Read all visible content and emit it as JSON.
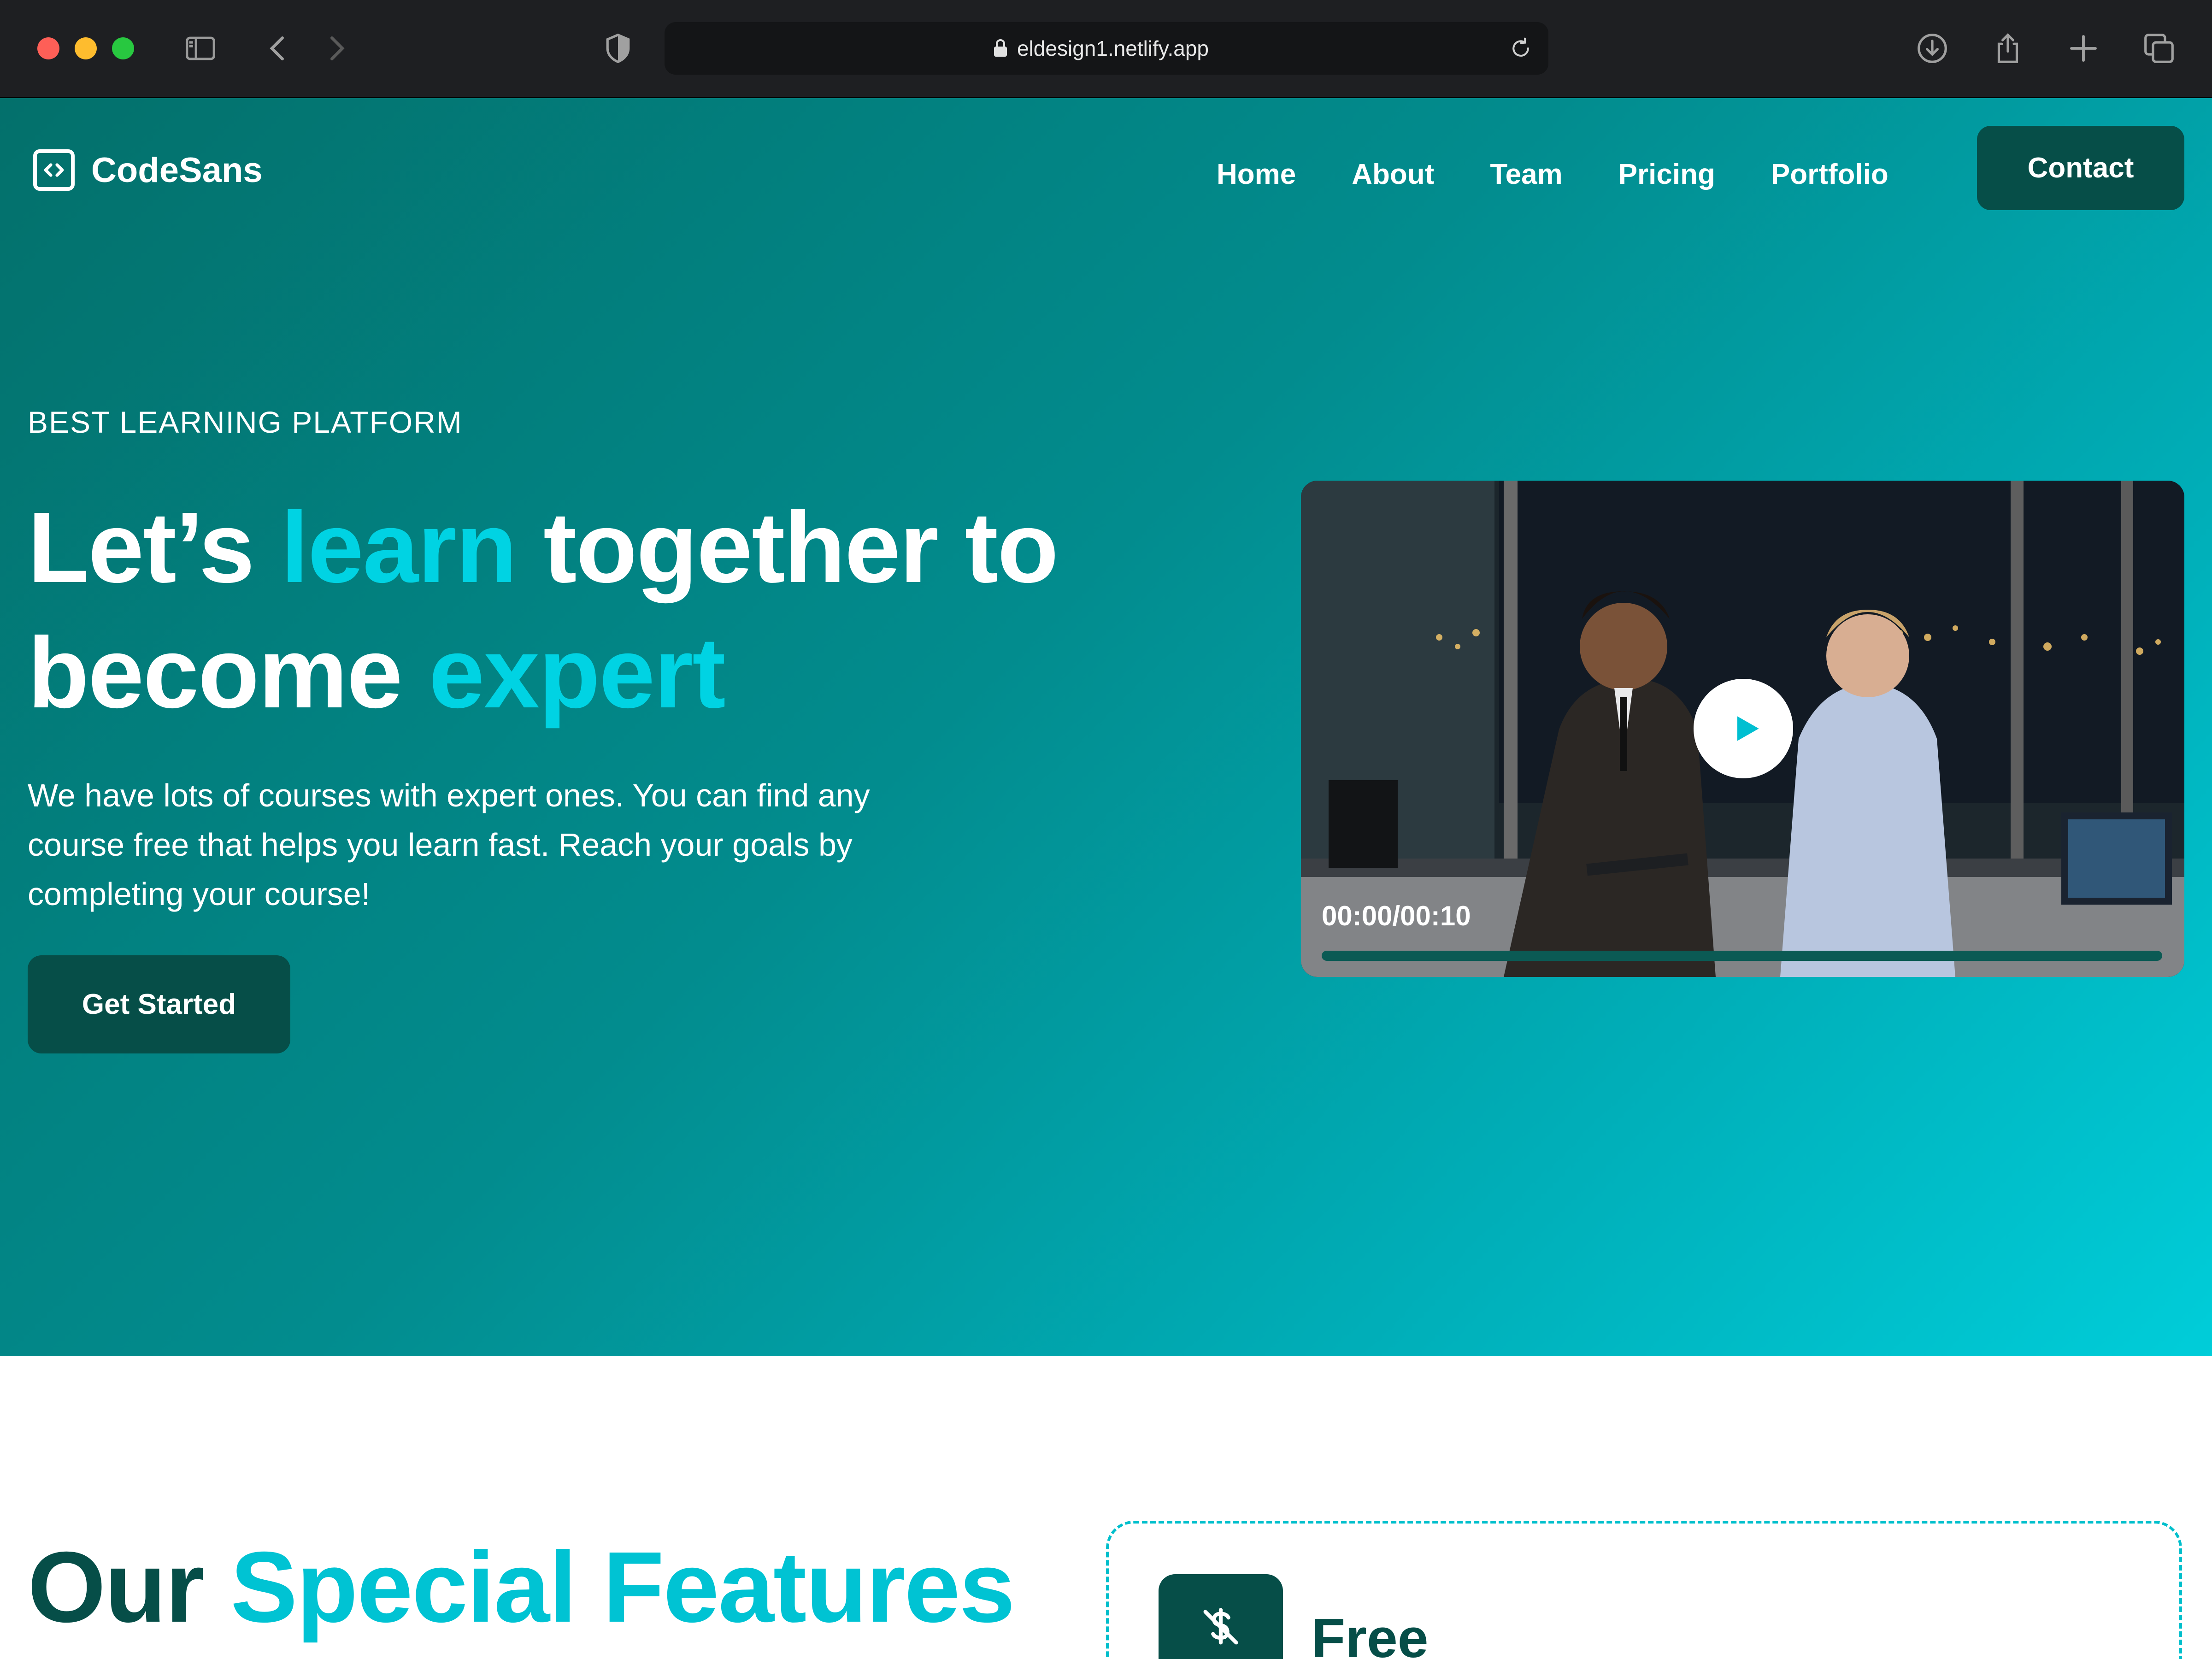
{
  "browser": {
    "url": "eldesign1.netlify.app"
  },
  "site": {
    "brand": "CodeSans",
    "nav": [
      "Home",
      "About",
      "Team",
      "Pricing",
      "Portfolio"
    ],
    "contact_label": "Contact"
  },
  "hero": {
    "eyebrow": "BEST LEARNING PLATFORM",
    "headline": {
      "part1": "Let’s ",
      "accent1": "learn",
      "part2": " together to become ",
      "accent2": "expert"
    },
    "lead": "We have lots of courses with expert ones. You can find any course free that helps you learn fast. Reach your goals by completing your course!",
    "cta_label": "Get Started",
    "video": {
      "time": "00:00/00:10",
      "progress": 0
    }
  },
  "features": {
    "title_part1": "Our ",
    "title_accent": "Special Features",
    "cards": [
      {
        "label": "Free",
        "icon": "dollar-off-icon"
      }
    ]
  },
  "colors": {
    "accent": "#00d3e3",
    "dark_teal": "#064e48",
    "hero_start": "#03706b",
    "hero_end": "#00cdd9"
  }
}
